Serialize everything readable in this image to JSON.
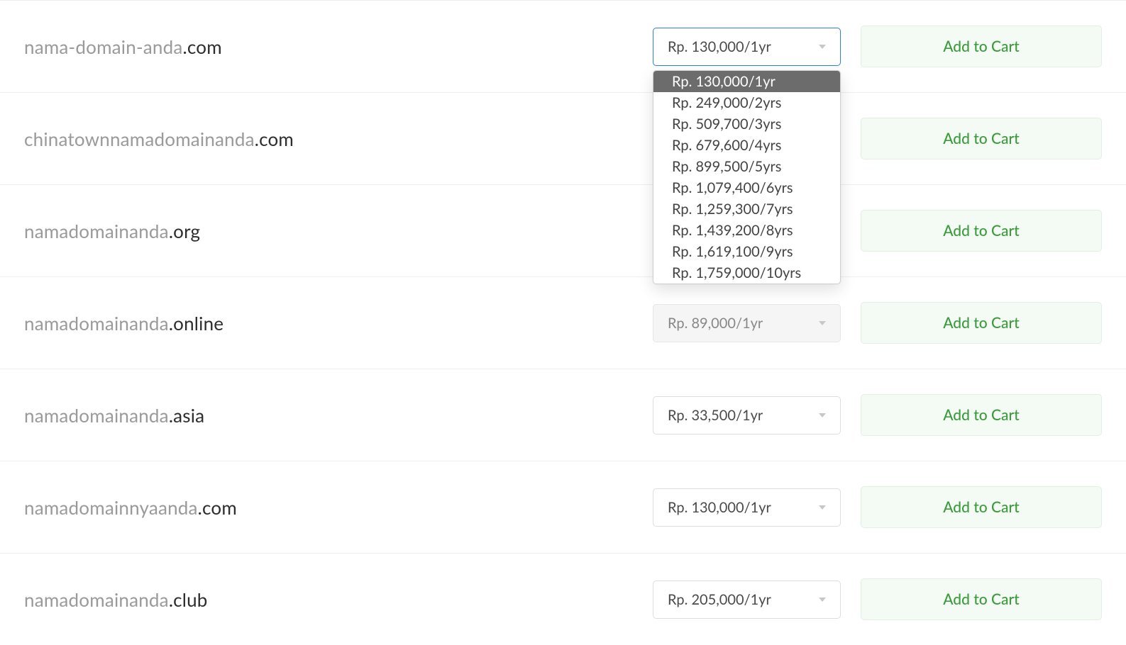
{
  "add_to_cart_label": "Add to Cart",
  "dropdown_options": [
    "Rp. 130,000/1yr",
    "Rp. 249,000/2yrs",
    "Rp. 509,700/3yrs",
    "Rp. 679,600/4yrs",
    "Rp. 899,500/5yrs",
    "Rp. 1,079,400/6yrs",
    "Rp. 1,259,300/7yrs",
    "Rp. 1,439,200/8yrs",
    "Rp. 1,619,100/9yrs",
    "Rp. 1,759,000/10yrs"
  ],
  "rows": [
    {
      "name": "nama-domain-anda",
      "tld": ".com",
      "price": "Rp. 130,000/1yr",
      "focused": true,
      "open": true,
      "muted": false
    },
    {
      "name": "chinatownnamadomainanda",
      "tld": ".com",
      "price": "",
      "focused": false,
      "open": false,
      "muted": false
    },
    {
      "name": "namadomainanda",
      "tld": ".org",
      "price": "",
      "focused": false,
      "open": false,
      "muted": false
    },
    {
      "name": "namadomainanda",
      "tld": ".online",
      "price": "Rp. 89,000/1yr",
      "focused": false,
      "open": false,
      "muted": true
    },
    {
      "name": "namadomainanda",
      "tld": ".asia",
      "price": "Rp. 33,500/1yr",
      "focused": false,
      "open": false,
      "muted": false
    },
    {
      "name": "namadomainnyaanda",
      "tld": ".com",
      "price": "Rp. 130,000/1yr",
      "focused": false,
      "open": false,
      "muted": false
    },
    {
      "name": "namadomainanda",
      "tld": ".club",
      "price": "Rp. 205,000/1yr",
      "focused": false,
      "open": false,
      "muted": false
    }
  ]
}
